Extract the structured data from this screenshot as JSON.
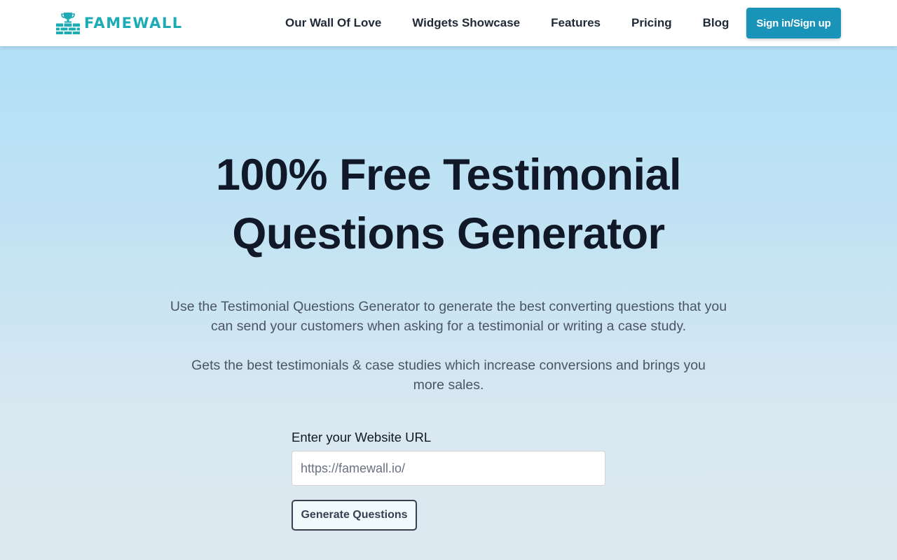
{
  "brand": {
    "name": "FAMEWALL",
    "logo_icon": "trophy-wall-icon",
    "color": "#1dacb6"
  },
  "nav": {
    "items": [
      {
        "label": "Our Wall Of Love"
      },
      {
        "label": "Widgets Showcase"
      },
      {
        "label": "Features"
      },
      {
        "label": "Pricing"
      },
      {
        "label": "Blog"
      }
    ],
    "signin_label": "Sign in/Sign up",
    "signin_color": "#1a93b8"
  },
  "hero": {
    "title_line1": "100% Free Testimonial",
    "title_line2": "Questions Generator",
    "description1": "Use the Testimonial Questions Generator to generate the best converting questions that you can send your customers when asking for a testimonial or writing a case study.",
    "description2": "Gets the best testimonials & case studies which increase conversions and brings you more sales."
  },
  "form": {
    "url_label": "Enter your Website URL",
    "url_placeholder": "https://famewall.io/",
    "url_value": "",
    "submit_label": "Generate Questions"
  }
}
